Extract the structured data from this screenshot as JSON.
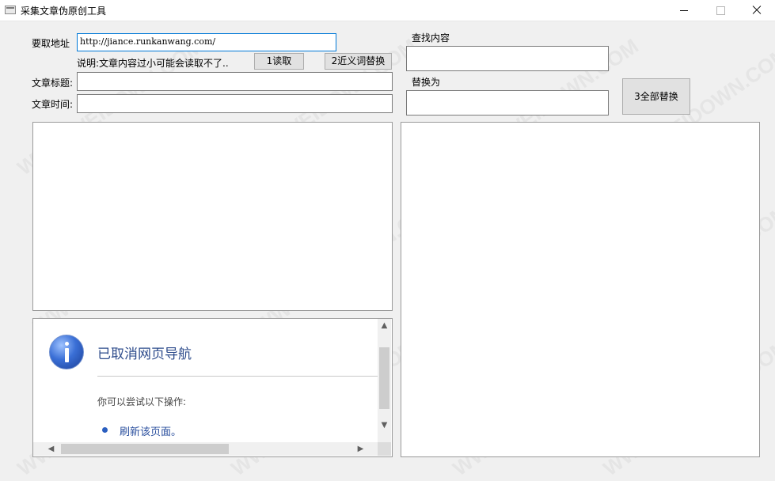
{
  "window": {
    "title": "采集文章伪原创工具",
    "minimize_glyph": "",
    "maximize_glyph": "",
    "close_glyph": ""
  },
  "form": {
    "url_label": "要取地址",
    "url_value": "http://jiance.runkanwang.com/",
    "note": "说明:文章内容过小可能会读取不了..",
    "read_button": "1读取",
    "synonym_button": "2近义词替换",
    "title_label": "文章标题:",
    "title_value": "",
    "time_label": "文章时间:",
    "time_value": "",
    "find_label": "查找内容",
    "find_value": "",
    "replace_label": "替换为",
    "replace_value": "",
    "replace_all_button": "3全部替换"
  },
  "browser": {
    "heading": "已取消网页导航",
    "subtext": "你可以尝试以下操作:",
    "link": "刷新该页面。",
    "up_arrow": "▲",
    "down_arrow": "▼",
    "left_arrow": "◀",
    "right_arrow": "▶"
  },
  "watermark": "WWW.WEIDOWN.COM",
  "colors": {
    "accent": "#0078d7",
    "link": "#2a4f9e",
    "heading": "#2e4c8c"
  }
}
